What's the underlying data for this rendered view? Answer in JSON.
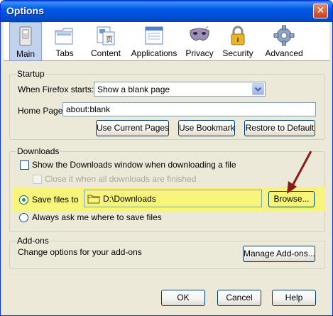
{
  "window": {
    "title": "Options"
  },
  "toolbar": {
    "items": [
      {
        "label": "Main",
        "icon": "main-switch-icon",
        "selected": true
      },
      {
        "label": "Tabs",
        "icon": "tabs-icon"
      },
      {
        "label": "Content",
        "icon": "content-icon"
      },
      {
        "label": "Applications",
        "icon": "applications-icon"
      },
      {
        "label": "Privacy",
        "icon": "privacy-mask-icon"
      },
      {
        "label": "Security",
        "icon": "security-lock-icon"
      },
      {
        "label": "Advanced",
        "icon": "advanced-gear-icon"
      }
    ]
  },
  "startup": {
    "title": "Startup",
    "when_label": "When Firefox starts:",
    "when_value": "Show a blank page",
    "home_label": "Home Page:",
    "home_value": "about:blank",
    "use_current": "Use Current Pages",
    "use_bookmark": "Use Bookmark",
    "restore_default": "Restore to Default"
  },
  "downloads": {
    "title": "Downloads",
    "show_window": "Show the Downloads window when downloading a file",
    "close_when_done": "Close it when all downloads are finished",
    "save_files_to": "Save files to",
    "save_path": "D:\\Downloads",
    "browse": "Browse...",
    "always_ask": "Always ask me where to save files"
  },
  "addons": {
    "title": "Add-ons",
    "description": "Change options for your add-ons",
    "manage": "Manage Add-ons..."
  },
  "footer": {
    "ok": "OK",
    "cancel": "Cancel",
    "help": "Help"
  },
  "colors": {
    "highlight": "#f6f57a",
    "arrow": "#8b1a1a",
    "titlebar": "#0058e6"
  }
}
